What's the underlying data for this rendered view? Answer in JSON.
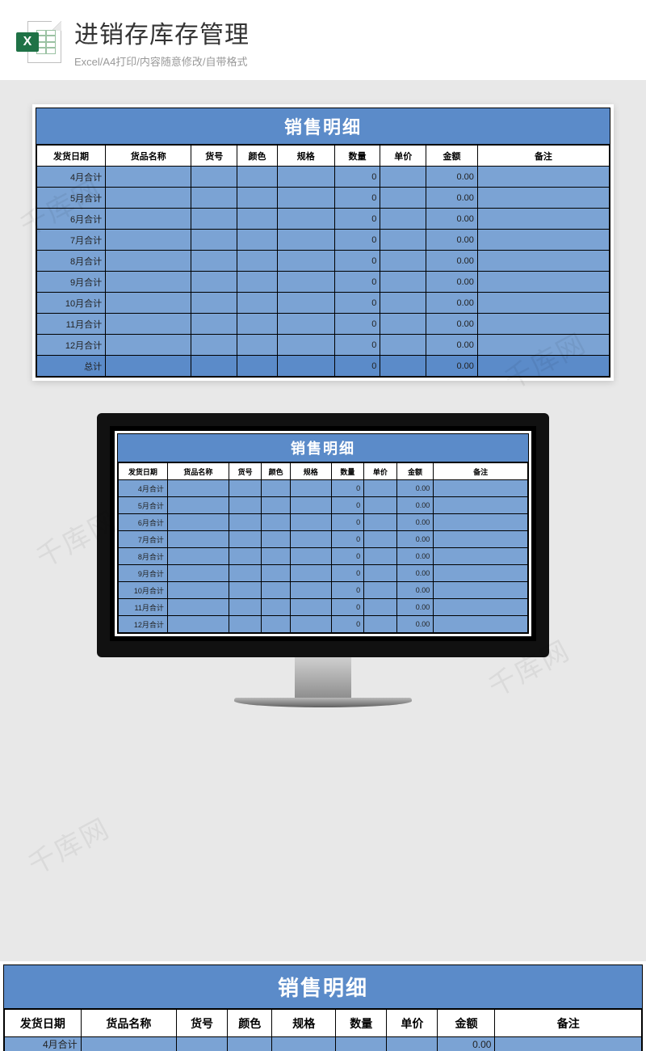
{
  "header": {
    "title": "进销存库存管理",
    "subtitle": "Excel/A4打印/内容随意修改/自带格式",
    "icon_letter": "X"
  },
  "sheet": {
    "title": "销售明细",
    "columns": [
      "发货日期",
      "货品名称",
      "货号",
      "颜色",
      "规格",
      "数量",
      "单价",
      "金额",
      "备注"
    ],
    "rows": [
      {
        "date": "4月合计",
        "qty": "0",
        "amt": "0.00"
      },
      {
        "date": "5月合计",
        "qty": "0",
        "amt": "0.00"
      },
      {
        "date": "6月合计",
        "qty": "0",
        "amt": "0.00"
      },
      {
        "date": "7月合计",
        "qty": "0",
        "amt": "0.00"
      },
      {
        "date": "8月合计",
        "qty": "0",
        "amt": "0.00"
      },
      {
        "date": "9月合计",
        "qty": "0",
        "amt": "0.00"
      },
      {
        "date": "10月合计",
        "qty": "0",
        "amt": "0.00"
      },
      {
        "date": "11月合计",
        "qty": "0",
        "amt": "0.00"
      },
      {
        "date": "12月合计",
        "qty": "0",
        "amt": "0.00"
      }
    ],
    "total": {
      "date": "总计",
      "qty": "0",
      "amt": "0.00"
    }
  },
  "bottom_crop": {
    "date": "4月合计",
    "amt": "0.00"
  },
  "watermark": "千库网"
}
